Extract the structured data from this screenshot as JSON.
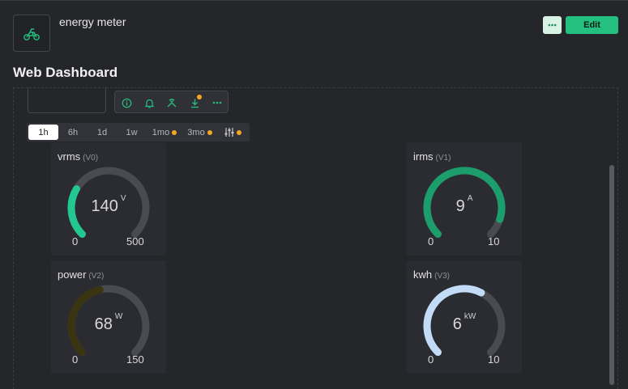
{
  "device": {
    "name": "energy meter",
    "icon": "motorcycle-icon"
  },
  "header": {
    "edit_label": "Edit",
    "more_icon": "ellipsis-icon"
  },
  "page": {
    "title": "Web Dashboard"
  },
  "toolbar": {
    "icons": [
      "info-icon",
      "bell-icon",
      "wrench-icon",
      "download-icon",
      "ellipsis-icon"
    ]
  },
  "time_ranges": [
    {
      "label": "1h",
      "active": true,
      "dot": false
    },
    {
      "label": "6h",
      "active": false,
      "dot": false
    },
    {
      "label": "1d",
      "active": false,
      "dot": false
    },
    {
      "label": "1w",
      "active": false,
      "dot": false
    },
    {
      "label": "1mo",
      "active": false,
      "dot": true
    },
    {
      "label": "3mo",
      "active": false,
      "dot": true
    }
  ],
  "widgets": [
    {
      "title": "vrms",
      "pin": "(V0)",
      "value": "140",
      "unit": "V",
      "min": "0",
      "max": "500",
      "fraction": 0.28,
      "color": "#23c891"
    },
    {
      "title": "irms",
      "pin": "(V1)",
      "value": "9",
      "unit": "A",
      "min": "0",
      "max": "10",
      "fraction": 0.9,
      "color": "#1b9e6c"
    },
    {
      "title": "power",
      "pin": "(V2)",
      "value": "68",
      "unit": "W",
      "min": "0",
      "max": "150",
      "fraction": 0.45,
      "color": "#3b3410"
    },
    {
      "title": "kwh",
      "pin": "(V3)",
      "value": "6",
      "unit": "kW",
      "min": "0",
      "max": "10",
      "fraction": 0.6,
      "color": "#c2dcf8"
    }
  ],
  "colors": {
    "accent": "#23c07f",
    "orange_dot": "#f5a623",
    "background": "#25262a",
    "widget_bg": "#2b2c31",
    "gauge_track": "#4a4b50"
  }
}
